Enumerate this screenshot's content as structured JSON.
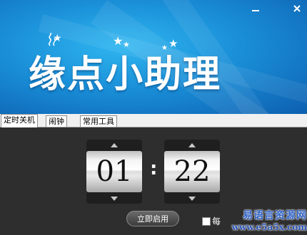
{
  "app": {
    "title": "缘点小助理",
    "minimize_glyph": "▀",
    "close_glyph": "✕"
  },
  "tabs": [
    {
      "label": "定时关机"
    },
    {
      "label": "闹钟"
    },
    {
      "label": "常用工具"
    }
  ],
  "timer": {
    "hours": "01",
    "minutes": "22",
    "separator": ":"
  },
  "actions": {
    "start_label": "立即启用",
    "checkbox_label": "每"
  },
  "watermark": {
    "line1": "易语言资源网",
    "line2": "www.e5a5x.com"
  },
  "colors": {
    "banner_blue": "#1a8fd8",
    "panel_dark": "#2e2e2e",
    "watermark_blue": "#2f62c7"
  }
}
